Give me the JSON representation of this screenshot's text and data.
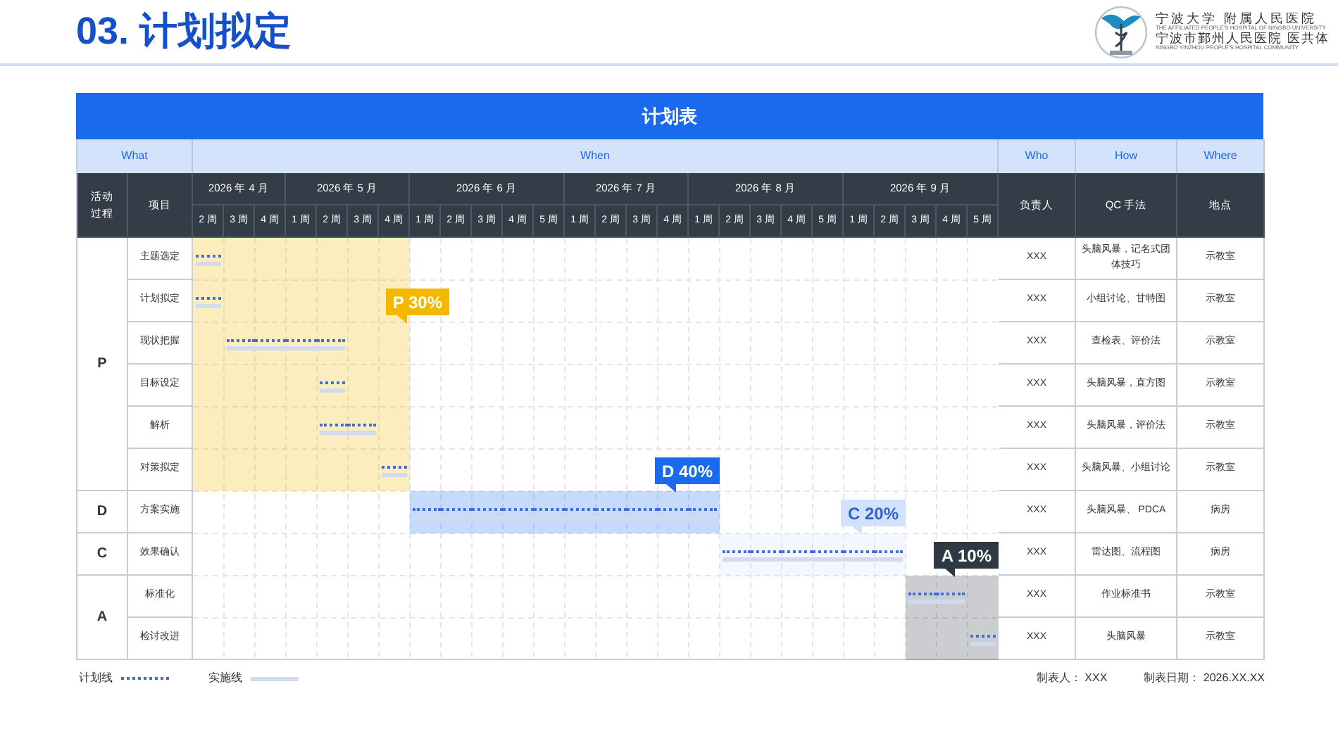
{
  "header": {
    "title": "03. 计划拟定",
    "logo": {
      "lines": [
        "宁波大学 附属人民医院",
        "THE AFFILIATED PEOPLE'S HOSPITAL OF NINGBO UNIVERSITY",
        "宁波市鄞州人民医院 医共体",
        "NINGBO YINZHOU PEOPLE'S HOSPITAL COMMUNITY"
      ]
    }
  },
  "table": {
    "title": "计划表",
    "groups": [
      "What",
      "When",
      "Who",
      "How",
      "Where"
    ],
    "columns": [
      "活动过程",
      "项目",
      "负责人",
      "QC 手法",
      "地点"
    ],
    "months": [
      {
        "label": "2026 年 4 月",
        "weeks": [
          "2 周",
          "3 周",
          "4 周"
        ]
      },
      {
        "label": "2026 年 5 月",
        "weeks": [
          "1 周",
          "2 周",
          "3 周",
          "4 周"
        ]
      },
      {
        "label": "2026 年 6 月",
        "weeks": [
          "1 周",
          "2 周",
          "3 周",
          "4 周",
          "5 周"
        ]
      },
      {
        "label": "2026 年 7 月",
        "weeks": [
          "1 周",
          "2 周",
          "3 周",
          "4 周"
        ]
      },
      {
        "label": "2026 年 8 月",
        "weeks": [
          "1 周",
          "2 周",
          "3 周",
          "4 周",
          "5 周"
        ]
      },
      {
        "label": "2026 年 9 月",
        "weeks": [
          "1 周",
          "2 周",
          "3 周",
          "4 周",
          "5 周"
        ]
      }
    ],
    "phases": [
      {
        "label": "P",
        "callout": "P 30%",
        "color": "#f5b800",
        "rows": [
          {
            "item": "主题选定",
            "scheduled": [
              true,
              false,
              false,
              false,
              false,
              false,
              false,
              false,
              false,
              false,
              false,
              false,
              false,
              false,
              false,
              false,
              false,
              false,
              false,
              false,
              false,
              false,
              false,
              false,
              false,
              false
            ],
            "who": "XXX",
            "how": "头脑风暴，记名式团体技巧",
            "where": "示教室"
          },
          {
            "item": "计划拟定",
            "scheduled": [
              true,
              false,
              false,
              false,
              false,
              false,
              false,
              false,
              false,
              false,
              false,
              false,
              false,
              false,
              false,
              false,
              false,
              false,
              false,
              false,
              false,
              false,
              false,
              false,
              false,
              false
            ],
            "who": "XXX",
            "how": "小组讨论、甘特图",
            "where": "示教室"
          },
          {
            "item": "现状把握",
            "scheduled": [
              false,
              true,
              true,
              true,
              true,
              false,
              false,
              false,
              false,
              false,
              false,
              false,
              false,
              false,
              false,
              false,
              false,
              false,
              false,
              false,
              false,
              false,
              false,
              false,
              false,
              false
            ],
            "who": "XXX",
            "how": "查检表、评价法",
            "where": "示教室"
          },
          {
            "item": "目标设定",
            "scheduled": [
              false,
              false,
              false,
              false,
              true,
              false,
              false,
              false,
              false,
              false,
              false,
              false,
              false,
              false,
              false,
              false,
              false,
              false,
              false,
              false,
              false,
              false,
              false,
              false,
              false,
              false
            ],
            "who": "XXX",
            "how": "头脑风暴，直方图",
            "where": "示教室"
          },
          {
            "item": "解析",
            "scheduled": [
              false,
              false,
              false,
              false,
              true,
              true,
              false,
              false,
              false,
              false,
              false,
              false,
              false,
              false,
              false,
              false,
              false,
              false,
              false,
              false,
              false,
              false,
              false,
              false,
              false,
              false
            ],
            "who": "XXX",
            "how": "头脑风暴，评价法",
            "where": "示教室"
          },
          {
            "item": "对策拟定",
            "scheduled": [
              false,
              false,
              false,
              false,
              false,
              false,
              true,
              false,
              false,
              false,
              false,
              false,
              false,
              false,
              false,
              false,
              false,
              false,
              false,
              false,
              false,
              false,
              false,
              false,
              false,
              false
            ],
            "who": "XXX",
            "how": "头脑风暴、小组讨论",
            "where": "示教室"
          }
        ]
      },
      {
        "label": "D",
        "callout": "D 40%",
        "color": "#1a6af0",
        "rows": [
          {
            "item": "方案实施",
            "scheduled": [
              false,
              false,
              false,
              false,
              false,
              false,
              false,
              true,
              true,
              true,
              true,
              true,
              true,
              true,
              true,
              true,
              true,
              false,
              false,
              false,
              false,
              false,
              false,
              false,
              false,
              false
            ],
            "who": "XXX",
            "how": "头脑风暴、 PDCA",
            "where": "病房"
          }
        ]
      },
      {
        "label": "C",
        "callout": "C 20%",
        "color": "#d3e2fc",
        "rows": [
          {
            "item": "效果确认",
            "scheduled": [
              false,
              false,
              false,
              false,
              false,
              false,
              false,
              false,
              false,
              false,
              false,
              false,
              false,
              false,
              false,
              false,
              false,
              true,
              true,
              true,
              true,
              true,
              true,
              false,
              false,
              false
            ],
            "who": "XXX",
            "how": "雷达图、流程图",
            "where": "病房"
          }
        ]
      },
      {
        "label": "A",
        "callout": "A 10%",
        "color": "#2f3944",
        "rows": [
          {
            "item": "标准化",
            "scheduled": [
              false,
              false,
              false,
              false,
              false,
              false,
              false,
              false,
              false,
              false,
              false,
              false,
              false,
              false,
              false,
              false,
              false,
              false,
              false,
              false,
              false,
              false,
              false,
              true,
              true,
              false
            ],
            "who": "XXX",
            "how": "作业标准书",
            "where": "示教室"
          },
          {
            "item": "检讨改进",
            "scheduled": [
              false,
              false,
              false,
              false,
              false,
              false,
              false,
              false,
              false,
              false,
              false,
              false,
              false,
              false,
              false,
              false,
              false,
              false,
              false,
              false,
              false,
              false,
              false,
              false,
              false,
              true
            ],
            "who": "XXX",
            "how": "头脑风暴",
            "where": "示教室"
          }
        ]
      }
    ]
  },
  "legend": [
    {
      "kind": "plan",
      "label": "计划线"
    },
    {
      "kind": "actual",
      "label": "实施线"
    }
  ],
  "footer": [
    "制表人： XXX",
    "制表日期： 2026.XX.XX"
  ]
}
